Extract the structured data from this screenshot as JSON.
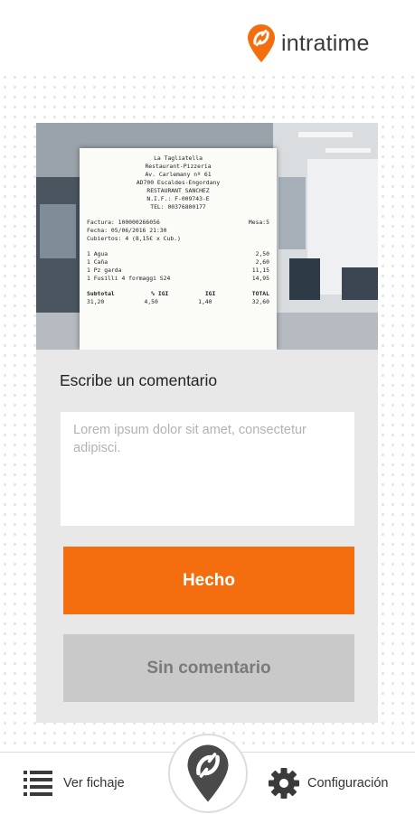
{
  "header": {
    "logo_text": "intratime",
    "logo_icon": "intratime-pin-icon",
    "brand_color": "#f46d0f"
  },
  "photo": {
    "receipt_lines": [
      "La Tagliatella",
      "Restaurant-Pizzeria",
      "Av. Carlemany nº 61",
      "AD700 Escaldes-Engordany",
      "RESTAURANT SANCHEZ",
      "N.I.F.: F-009743-E",
      "TEL: 00376800177"
    ],
    "factura": "Factura: 100000266056",
    "mesa": "Mesa:5",
    "fecha": "Fecha: 05/06/2016 21:30",
    "cubiertos": "Cubiertos: 4 (8,15€ x Cub.)",
    "items": [
      {
        "name": "1 Agua",
        "price": "2,50"
      },
      {
        "name": "1 Caña",
        "price": "2,60"
      },
      {
        "name": "1 Pz garda",
        "price": "11,15"
      },
      {
        "name": "1 Fusilli 4 formaggi S24",
        "price": "14,95"
      }
    ],
    "totals_header": [
      "Subtotal",
      "% IGI",
      "IGI",
      "TOTAL"
    ],
    "totals_values": [
      "31,20",
      "4,50",
      "1,40",
      "32,60"
    ]
  },
  "comment": {
    "label": "Escribe un comentario",
    "placeholder": "Lorem ipsum dolor sit amet, consectetur adipisci."
  },
  "buttons": {
    "done_label": "Hecho",
    "no_comment_label": "Sin comentario"
  },
  "bottom_nav": {
    "left_label": "Ver fichaje",
    "left_icon": "list-icon",
    "right_label": "Configuración",
    "right_icon": "gear-icon",
    "center_icon": "intratime-clock-in-icon"
  }
}
